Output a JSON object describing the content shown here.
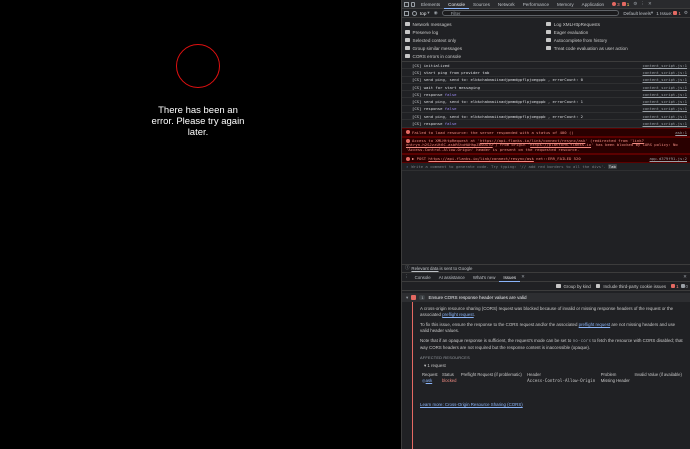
{
  "page": {
    "error_text": "There has been an error. Please try again later."
  },
  "devtools": {
    "tabs": [
      "Elements",
      "Console",
      "Sources",
      "Network",
      "Performance",
      "Memory",
      "Application"
    ],
    "active_tab": "Console",
    "error_count": "3",
    "warning_count": "1",
    "toolbar": {
      "context": "top",
      "filter_placeholder": "Filter",
      "levels": "Default levels",
      "issues": "1 Issue:",
      "issues_count": "1"
    },
    "settings_left": [
      "Network messages",
      "Preserve log",
      "Selected context only",
      "Group similar messages",
      "CORS errors in console"
    ],
    "settings_right": [
      "Log XMLHttpRequests",
      "Eager evaluation",
      "Autocomplete from history",
      "Treat code evaluation as user action"
    ],
    "console_lines": [
      {
        "msg": "[CS] initialized",
        "src": "content_script.js:1"
      },
      {
        "msg": "[CS] start ping from provider tab",
        "src": "content_script.js:1"
      },
      {
        "msg": "[CS] send ping, send to: elbkchakmaiinadjpmmdgpflpjoegppb , errorCount: 0",
        "src": "content_script.js:1"
      },
      {
        "msg": "[CS] wait for start messaging",
        "src": "content_script.js:1"
      },
      {
        "msg": "[CS] response",
        "kw": "false",
        "src": "content_script.js:1"
      },
      {
        "msg": "[CS] send ping, send to: elbkchakmaiinadjpmmdgpflpjoegppb , errorCount: 1",
        "src": "content_script.js:1"
      },
      {
        "msg": "[CS] response",
        "kw": "false",
        "src": "content_script.js:1"
      },
      {
        "msg": "[CS] send ping, send to: elbkchakmaiinadjpmmdgpflpjoegppb , errorCount: 2",
        "src": "content_script.js:1"
      },
      {
        "msg": "[CS] response",
        "kw": "false",
        "src": "content_script.js:1"
      }
    ],
    "errors": {
      "e1": "Failed to load resource: the server responded with a status of 400 ()",
      "e1_src": "ask:1",
      "e2_a": "Access to XMLHttpRequest at '",
      "e2_link1": "https://api.flanks.io/link/connect/resync/ask",
      "e2_b": "' (redirected from '",
      "e2_link2": "link?entryn.h2SJzzUt6C.asbRStoHAHhpZBSuGTU",
      "e2_c": "') from origin '",
      "e2_link3": "https://platform.flanks.io",
      "e2_d": "' has been blocked by CORS policy: No 'Access-Control-Allow-Origin' header is present on the requested resource.",
      "e3_a": "▶ POST",
      "e3_link": "https://api.flanks.io/link/connect/resync/ask",
      "e3_b": "net::ERR_FAILED 520",
      "e3_src": "app.d379f91.js:2"
    },
    "prompt": "Write a comment to generate code. Try typing: '// add red borders to all the divs'.",
    "prompt_key": "Tab",
    "relevant": {
      "link": "Relevant data",
      "rest": "is sent to Google"
    },
    "drawer_tabs": [
      "Console",
      "AI assistance",
      "What's new",
      "Issues"
    ],
    "active_drawer_tab": "Issues",
    "issues_toolbar": {
      "group": "Group by kind",
      "third_party": "Include third-party cookie issues",
      "count": "1",
      "count2": "0"
    },
    "issue": {
      "title": "Ensure CORS response header values are valid",
      "p1_a": "A cross-origin resource sharing (CORS) request was blocked because of invalid or missing response headers of the request or the associated",
      "p1_link": "preflight request",
      "p2_a": "To fix this issue, ensure the response to the CORS request and/or the associated",
      "p2_link": "preflight request",
      "p2_b": "are not missing headers and use valid header values.",
      "p3_a": "Note that if an opaque response is sufficient, the request's mode can be set to",
      "p3_code": "no-cors",
      "p3_b": "to fetch the resource with CORS disabled; that way CORS headers are not required but the response content is inaccessible (opaque).",
      "affected": "AFFECTED RESOURCES",
      "req_count": "▾ 1 request",
      "headers": [
        "Request",
        "Status",
        "Preflight Request (if problematic)",
        "Header",
        "Problem",
        "Invalid Value (if available)"
      ],
      "row": [
        "ask",
        "blocked",
        "",
        "Access-Control-Allow-Origin",
        "Missing Header",
        ""
      ],
      "learn_more": "Learn more: Cross-Origin Resource Sharing (CORS)"
    }
  }
}
